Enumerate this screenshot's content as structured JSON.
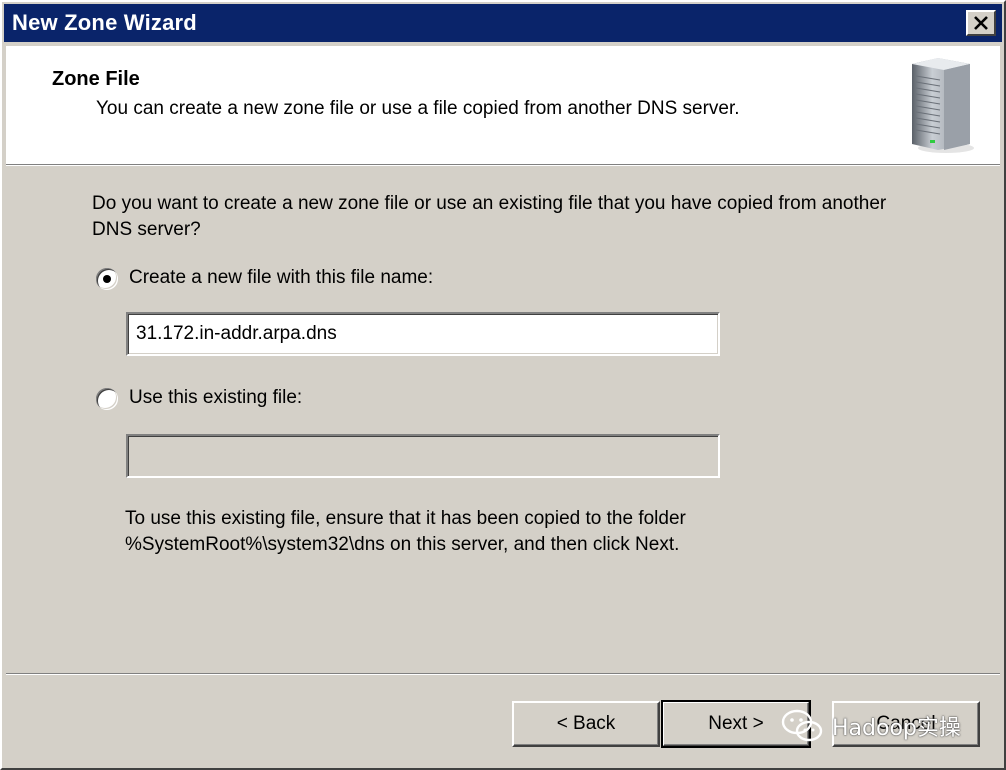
{
  "window": {
    "title": "New Zone Wizard"
  },
  "header": {
    "title": "Zone File",
    "subtitle": "You can create a new zone file or use a file copied from another DNS server."
  },
  "body": {
    "question": "Do you want to create a new zone file or use an existing file that you have copied from another DNS server?",
    "option_new": {
      "label": "Create a new file with this file name:",
      "selected": true,
      "value": "31.172.in-addr.arpa.dns"
    },
    "option_existing": {
      "label": "Use this existing file:",
      "selected": false,
      "value": ""
    },
    "note_line1": "To use this existing file, ensure that it has been copied to the folder",
    "note_line2": "%SystemRoot%\\system32\\dns on this server, and then click Next."
  },
  "buttons": {
    "back": "< Back",
    "next": "Next >",
    "cancel": "Cancel"
  },
  "watermark": {
    "text": "Hadoop实操"
  },
  "colors": {
    "titlebar": "#0a246a",
    "face": "#d4d0c8"
  }
}
